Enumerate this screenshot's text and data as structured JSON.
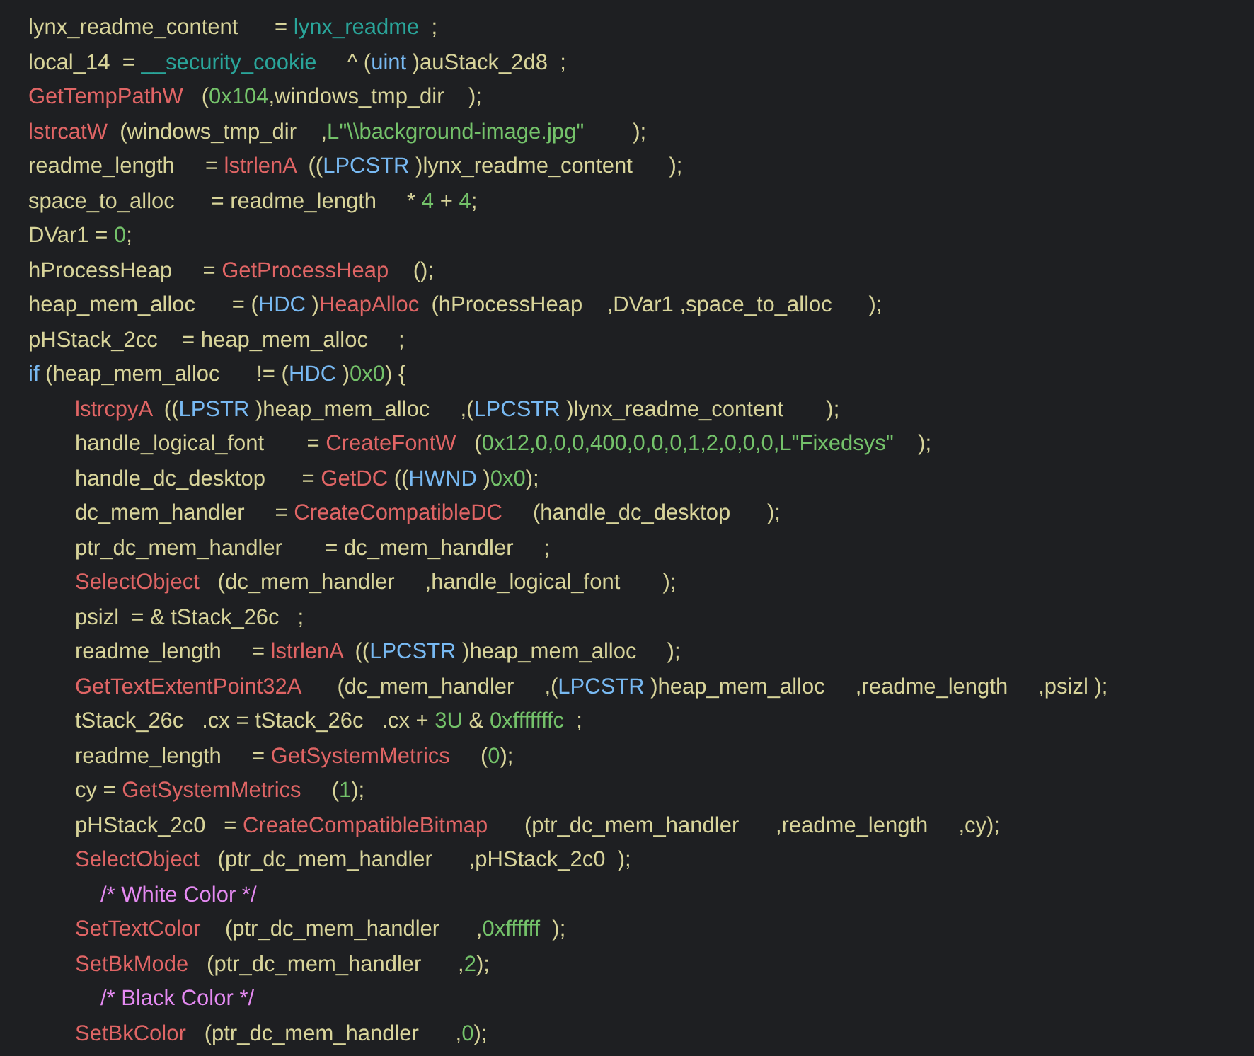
{
  "code_lines": [
    {
      "kind": "code",
      "tokens": [
        {
          "kind": "plain",
          "text": "lynx_readme_content      = "
        },
        {
          "kind": "global",
          "text": "lynx_readme"
        },
        {
          "kind": "plain",
          "text": "  ;"
        }
      ]
    },
    {
      "kind": "code",
      "tokens": [
        {
          "kind": "plain",
          "text": "local_14  = "
        },
        {
          "kind": "global",
          "text": "__security_cookie"
        },
        {
          "kind": "plain",
          "text": "     ^ ("
        },
        {
          "kind": "type",
          "text": "uint"
        },
        {
          "kind": "plain",
          "text": " )auStack_2d8  ;"
        }
      ]
    },
    {
      "kind": "code",
      "tokens": [
        {
          "kind": "func",
          "text": "GetTempPathW"
        },
        {
          "kind": "plain",
          "text": "   ("
        },
        {
          "kind": "number",
          "text": "0x104"
        },
        {
          "kind": "plain",
          "text": ",windows_tmp_dir    );"
        }
      ]
    },
    {
      "kind": "code",
      "tokens": [
        {
          "kind": "func",
          "text": "lstrcatW"
        },
        {
          "kind": "plain",
          "text": "  (windows_tmp_dir    ,"
        },
        {
          "kind": "string",
          "text": "L\"\\\\background-image.jpg\""
        },
        {
          "kind": "plain",
          "text": "        );"
        }
      ]
    },
    {
      "kind": "code",
      "tokens": [
        {
          "kind": "plain",
          "text": "readme_length     = "
        },
        {
          "kind": "func",
          "text": "lstrlenA"
        },
        {
          "kind": "plain",
          "text": "  (("
        },
        {
          "kind": "type",
          "text": "LPCSTR"
        },
        {
          "kind": "plain",
          "text": " )lynx_readme_content      );"
        }
      ]
    },
    {
      "kind": "code",
      "tokens": [
        {
          "kind": "plain",
          "text": "space_to_alloc      = readme_length     * "
        },
        {
          "kind": "number",
          "text": "4"
        },
        {
          "kind": "plain",
          "text": " + "
        },
        {
          "kind": "number",
          "text": "4"
        },
        {
          "kind": "plain",
          "text": ";"
        }
      ]
    },
    {
      "kind": "code",
      "tokens": [
        {
          "kind": "plain",
          "text": "DVar1 = "
        },
        {
          "kind": "number",
          "text": "0"
        },
        {
          "kind": "plain",
          "text": ";"
        }
      ]
    },
    {
      "kind": "code",
      "tokens": [
        {
          "kind": "plain",
          "text": "hProcessHeap     = "
        },
        {
          "kind": "func",
          "text": "GetProcessHeap"
        },
        {
          "kind": "plain",
          "text": "    ();"
        }
      ]
    },
    {
      "kind": "code",
      "tokens": [
        {
          "kind": "plain",
          "text": "heap_mem_alloc      = ("
        },
        {
          "kind": "type",
          "text": "HDC"
        },
        {
          "kind": "plain",
          "text": " )"
        },
        {
          "kind": "func",
          "text": "HeapAlloc"
        },
        {
          "kind": "plain",
          "text": "  (hProcessHeap    ,DVar1 ,space_to_alloc      );"
        }
      ]
    },
    {
      "kind": "code",
      "tokens": [
        {
          "kind": "plain",
          "text": "pHStack_2cc    = heap_mem_alloc     ;"
        }
      ]
    },
    {
      "kind": "code",
      "tokens": [
        {
          "kind": "keyword",
          "text": "if"
        },
        {
          "kind": "plain",
          "text": " (heap_mem_alloc      != ("
        },
        {
          "kind": "type",
          "text": "HDC"
        },
        {
          "kind": "plain",
          "text": " )"
        },
        {
          "kind": "number",
          "text": "0x0"
        },
        {
          "kind": "plain",
          "text": ") {"
        }
      ],
      "children": [
        {
          "kind": "code",
          "tokens": [
            {
              "kind": "func",
              "text": "lstrcpyA"
            },
            {
              "kind": "plain",
              "text": "  (("
            },
            {
              "kind": "type",
              "text": "LPSTR"
            },
            {
              "kind": "plain",
              "text": " )heap_mem_alloc     ,("
            },
            {
              "kind": "type",
              "text": "LPCSTR"
            },
            {
              "kind": "plain",
              "text": " )lynx_readme_content       );"
            }
          ]
        },
        {
          "kind": "code",
          "tokens": [
            {
              "kind": "plain",
              "text": "handle_logical_font       = "
            },
            {
              "kind": "func",
              "text": "CreateFontW"
            },
            {
              "kind": "plain",
              "text": "   ("
            },
            {
              "kind": "number",
              "text": "0x12,0,0,0,400,0,0,0,1,2,0,0,0,"
            },
            {
              "kind": "string",
              "text": "L\"Fixedsys\""
            },
            {
              "kind": "plain",
              "text": "    );"
            }
          ]
        },
        {
          "kind": "code",
          "tokens": [
            {
              "kind": "plain",
              "text": "handle_dc_desktop      = "
            },
            {
              "kind": "func",
              "text": "GetDC"
            },
            {
              "kind": "plain",
              "text": " (("
            },
            {
              "kind": "type",
              "text": "HWND"
            },
            {
              "kind": "plain",
              "text": " )"
            },
            {
              "kind": "number",
              "text": "0x0"
            },
            {
              "kind": "plain",
              "text": ");"
            }
          ]
        },
        {
          "kind": "code",
          "tokens": [
            {
              "kind": "plain",
              "text": "dc_mem_handler     = "
            },
            {
              "kind": "func",
              "text": "CreateCompatibleDC"
            },
            {
              "kind": "plain",
              "text": "     (handle_dc_desktop      );"
            }
          ]
        },
        {
          "kind": "code",
          "tokens": [
            {
              "kind": "plain",
              "text": "ptr_dc_mem_handler       = dc_mem_handler     ;"
            }
          ]
        },
        {
          "kind": "code",
          "tokens": [
            {
              "kind": "func",
              "text": "SelectObject"
            },
            {
              "kind": "plain",
              "text": "   (dc_mem_handler     ,handle_logical_font       );"
            }
          ]
        },
        {
          "kind": "code",
          "tokens": [
            {
              "kind": "plain",
              "text": "psizl  = & tStack_26c   ;"
            }
          ]
        },
        {
          "kind": "code",
          "tokens": [
            {
              "kind": "plain",
              "text": "readme_length     = "
            },
            {
              "kind": "func",
              "text": "lstrlenA"
            },
            {
              "kind": "plain",
              "text": "  (("
            },
            {
              "kind": "type",
              "text": "LPCSTR"
            },
            {
              "kind": "plain",
              "text": " )heap_mem_alloc     );"
            }
          ]
        },
        {
          "kind": "code",
          "tokens": [
            {
              "kind": "func",
              "text": "GetTextExtentPoint32A"
            },
            {
              "kind": "plain",
              "text": "      (dc_mem_handler     ,("
            },
            {
              "kind": "type",
              "text": "LPCSTR"
            },
            {
              "kind": "plain",
              "text": " )heap_mem_alloc     ,readme_length     ,psizl );"
            }
          ]
        },
        {
          "kind": "code",
          "tokens": [
            {
              "kind": "plain",
              "text": "tStack_26c   .cx = tStack_26c   .cx + "
            },
            {
              "kind": "number",
              "text": "3U"
            },
            {
              "kind": "plain",
              "text": " & "
            },
            {
              "kind": "number",
              "text": "0xfffffffc"
            },
            {
              "kind": "plain",
              "text": "  ;"
            }
          ]
        },
        {
          "kind": "code",
          "tokens": [
            {
              "kind": "plain",
              "text": "readme_length     = "
            },
            {
              "kind": "func",
              "text": "GetSystemMetrics"
            },
            {
              "kind": "plain",
              "text": "     ("
            },
            {
              "kind": "number",
              "text": "0"
            },
            {
              "kind": "plain",
              "text": ");"
            }
          ]
        },
        {
          "kind": "code",
          "tokens": [
            {
              "kind": "plain",
              "text": "cy = "
            },
            {
              "kind": "func",
              "text": "GetSystemMetrics"
            },
            {
              "kind": "plain",
              "text": "     ("
            },
            {
              "kind": "number",
              "text": "1"
            },
            {
              "kind": "plain",
              "text": ");"
            }
          ]
        },
        {
          "kind": "code",
          "tokens": [
            {
              "kind": "plain",
              "text": "pHStack_2c0   = "
            },
            {
              "kind": "func",
              "text": "CreateCompatibleBitmap"
            },
            {
              "kind": "plain",
              "text": "      (ptr_dc_mem_handler      ,readme_length     ,cy);"
            }
          ]
        },
        {
          "kind": "code",
          "tokens": [
            {
              "kind": "func",
              "text": "SelectObject"
            },
            {
              "kind": "plain",
              "text": "   (ptr_dc_mem_handler      ,pHStack_2c0  );"
            }
          ]
        },
        {
          "kind": "comment",
          "tokens": [
            {
              "kind": "comment",
              "text": "/* White Color */"
            }
          ]
        },
        {
          "kind": "code",
          "tokens": [
            {
              "kind": "func",
              "text": "SetTextColor"
            },
            {
              "kind": "plain",
              "text": "    (ptr_dc_mem_handler      ,"
            },
            {
              "kind": "number",
              "text": "0xffffff"
            },
            {
              "kind": "plain",
              "text": "  );"
            }
          ]
        },
        {
          "kind": "code",
          "tokens": [
            {
              "kind": "func",
              "text": "SetBkMode"
            },
            {
              "kind": "plain",
              "text": "   (ptr_dc_mem_handler      ,"
            },
            {
              "kind": "number",
              "text": "2"
            },
            {
              "kind": "plain",
              "text": ");"
            }
          ]
        },
        {
          "kind": "comment",
          "tokens": [
            {
              "kind": "comment",
              "text": "/* Black Color */"
            }
          ]
        },
        {
          "kind": "code",
          "tokens": [
            {
              "kind": "func",
              "text": "SetBkColor"
            },
            {
              "kind": "plain",
              "text": "   (ptr_dc_mem_handler      ,"
            },
            {
              "kind": "number",
              "text": "0"
            },
            {
              "kind": "plain",
              "text": ");"
            }
          ]
        }
      ]
    }
  ]
}
